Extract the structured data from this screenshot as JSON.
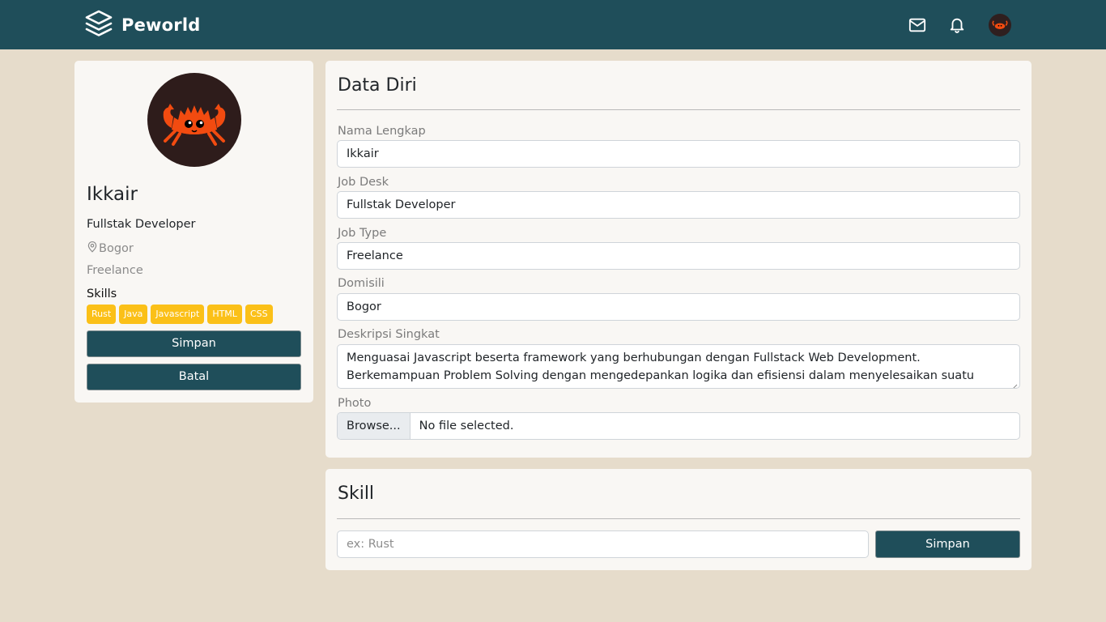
{
  "navbar": {
    "brand": "Peworld",
    "icons": [
      "layers-logo-icon",
      "mail-icon",
      "bell-icon"
    ],
    "bg_color": "#1f4e5a"
  },
  "profile": {
    "name": "Ikkair",
    "job": "Fullstak Developer",
    "location": "Bogor",
    "job_type": "Freelance",
    "skills_label": "Skills",
    "skills": [
      "Rust",
      "Java",
      "Javascript",
      "HTML",
      "CSS"
    ],
    "save_label": "Simpan",
    "cancel_label": "Batal"
  },
  "data_diri": {
    "title": "Data Diri",
    "fields": {
      "nama": {
        "label": "Nama Lengkap",
        "value": "Ikkair"
      },
      "job_desk": {
        "label": "Job Desk",
        "value": "Fullstak Developer"
      },
      "job_type": {
        "label": "Job Type",
        "value": "Freelance"
      },
      "domisili": {
        "label": "Domisili",
        "value": "Bogor"
      },
      "deskripsi": {
        "label": "Deskripsi Singkat",
        "value": "Menguasai Javascript beserta framework yang berhubungan dengan Fullstack Web Development. Berkemampuan Problem Solving dengan mengedepankan logika dan efisiensi dalam menyelesaikan suatu masalah."
      },
      "photo": {
        "label": "Photo",
        "browse_label": "Browse...",
        "status": "No file selected."
      }
    }
  },
  "skill_section": {
    "title": "Skill",
    "placeholder": "ex: Rust",
    "save_label": "Simpan"
  },
  "colors": {
    "page_bg": "#e6dccb",
    "accent": "#1f4e5a",
    "tag": "#fbc018",
    "avatar_bg": "#2e1c1b",
    "crab": "#f24b10"
  }
}
